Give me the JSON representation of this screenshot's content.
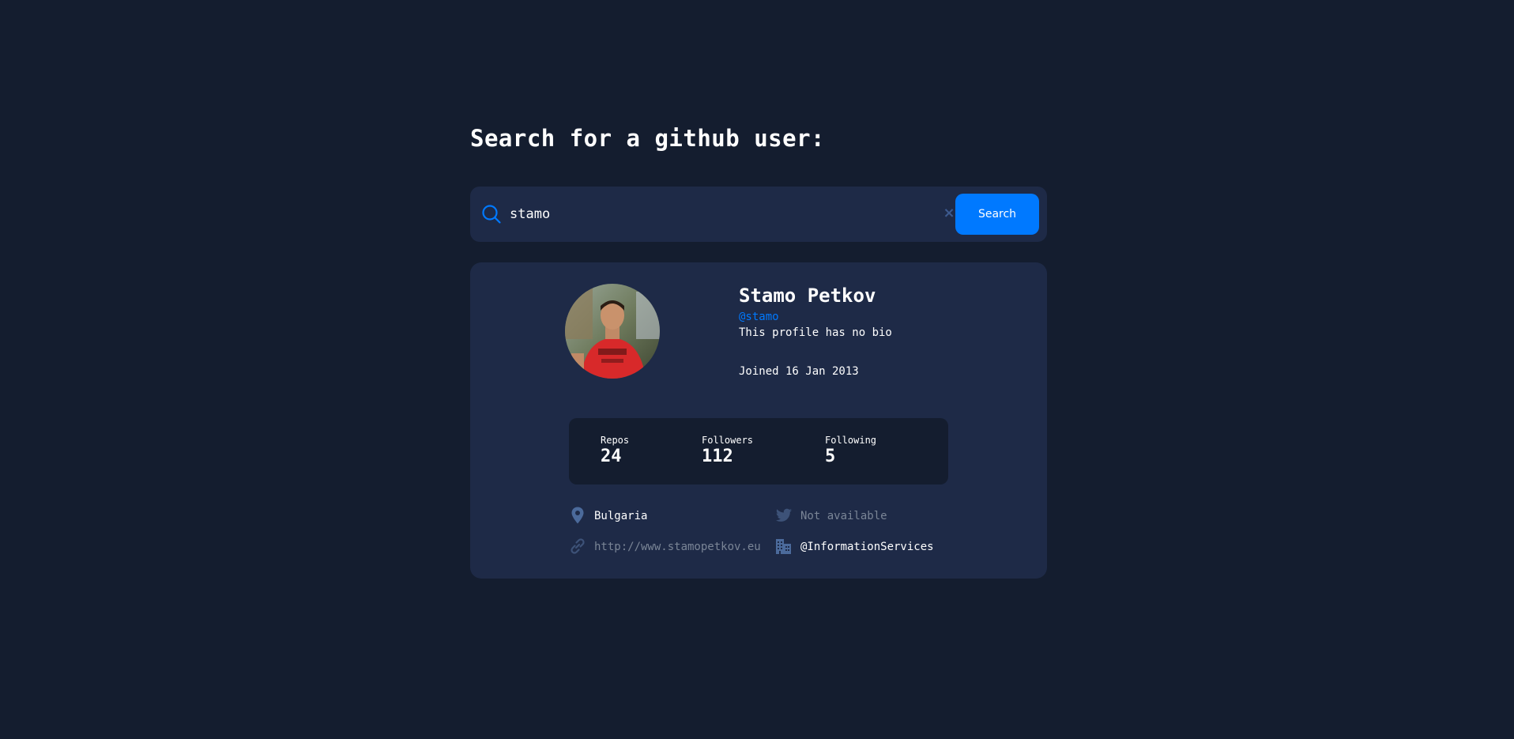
{
  "page": {
    "heading": "Search for a github user:"
  },
  "search": {
    "value": "stamo",
    "button_label": "Search",
    "clear_symbol": "×",
    "icon": "search-icon"
  },
  "profile": {
    "name": "Stamo Petkov",
    "login": "@stamo",
    "bio": "This profile has no bio",
    "joined": "Joined 16 Jan 2013",
    "avatar_icon": "avatar-photo"
  },
  "stats": {
    "repos": {
      "label": "Repos",
      "value": "24"
    },
    "followers": {
      "label": "Followers",
      "value": "112"
    },
    "following": {
      "label": "Following",
      "value": "5"
    }
  },
  "info": {
    "location": {
      "text": "Bulgaria",
      "icon": "location-pin-icon"
    },
    "twitter": {
      "text": "Not available",
      "icon": "twitter-icon"
    },
    "blog": {
      "text": "http://www.stamopetkov.eu",
      "icon": "link-icon"
    },
    "company": {
      "text": "@InformationServices",
      "icon": "office-building-icon"
    }
  },
  "colors": {
    "background": "#141d2f",
    "card": "#1e2a47",
    "accent": "#0079ff",
    "muted_text": "#7a8596",
    "icon": "#4b6a9b"
  }
}
